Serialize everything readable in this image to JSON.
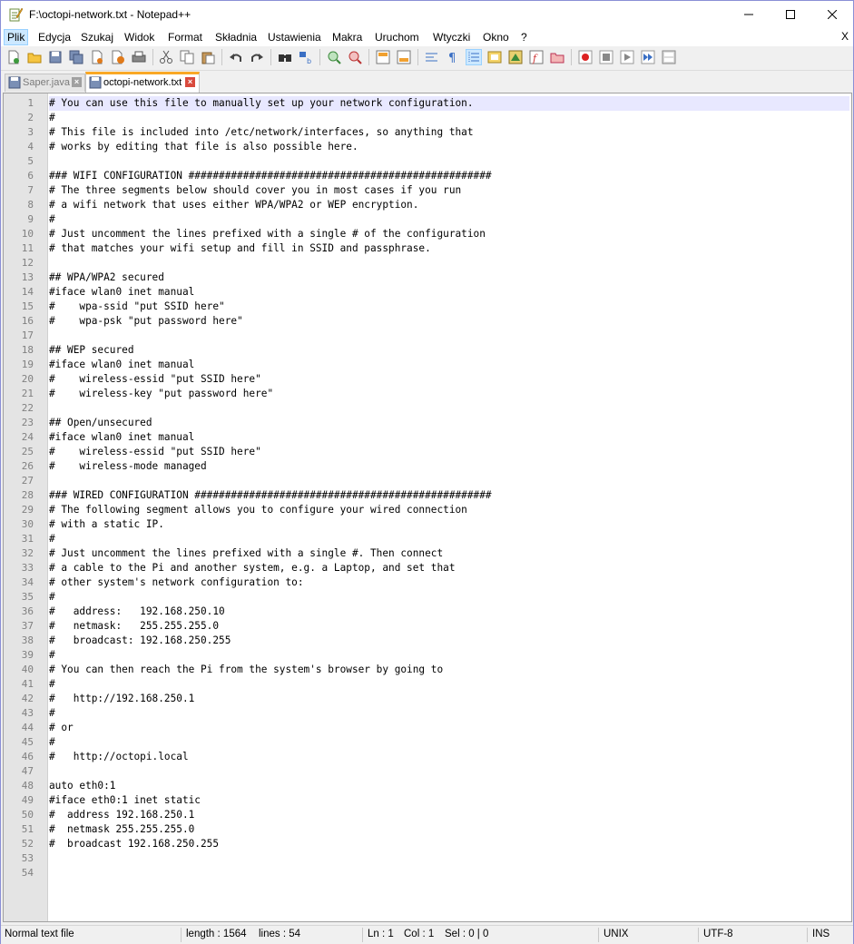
{
  "window": {
    "title": "F:\\octopi-network.txt - Notepad++"
  },
  "menu": [
    "Plik",
    "Edycja",
    "Szukaj",
    "Widok",
    "Format",
    "Składnia",
    "Ustawienia",
    "Makra",
    "Uruchom",
    "Wtyczki",
    "Okno",
    "?"
  ],
  "menu_close": "X",
  "tabs": [
    {
      "label": "Saper.java"
    },
    {
      "label": "octopi-network.txt"
    }
  ],
  "editor": {
    "lines": [
      "# You can use this file to manually set up your network configuration.",
      "#",
      "# This file is included into /etc/network/interfaces, so anything that",
      "# works by editing that file is also possible here.",
      "",
      "### WIFI CONFIGURATION ##################################################",
      "# The three segments below should cover you in most cases if you run",
      "# a wifi network that uses either WPA/WPA2 or WEP encryption.",
      "#",
      "# Just uncomment the lines prefixed with a single # of the configuration",
      "# that matches your wifi setup and fill in SSID and passphrase.",
      "",
      "## WPA/WPA2 secured",
      "#iface wlan0 inet manual",
      "#    wpa-ssid \"put SSID here\"",
      "#    wpa-psk \"put password here\"",
      "",
      "## WEP secured",
      "#iface wlan0 inet manual",
      "#    wireless-essid \"put SSID here\"",
      "#    wireless-key \"put password here\"",
      "",
      "## Open/unsecured",
      "#iface wlan0 inet manual",
      "#    wireless-essid \"put SSID here\"",
      "#    wireless-mode managed",
      "",
      "### WIRED CONFIGURATION #################################################",
      "# The following segment allows you to configure your wired connection",
      "# with a static IP.",
      "#",
      "# Just uncomment the lines prefixed with a single #. Then connect",
      "# a cable to the Pi and another system, e.g. a Laptop, and set that",
      "# other system's network configuration to:",
      "#",
      "#   address:   192.168.250.10",
      "#   netmask:   255.255.255.0",
      "#   broadcast: 192.168.250.255",
      "#",
      "# You can then reach the Pi from the system's browser by going to",
      "#",
      "#   http://192.168.250.1",
      "#",
      "# or",
      "#",
      "#   http://octopi.local",
      "",
      "auto eth0:1",
      "#iface eth0:1 inet static",
      "#  address 192.168.250.1",
      "#  netmask 255.255.255.0",
      "#  broadcast 192.168.250.255",
      "",
      ""
    ]
  },
  "status": {
    "filetype": "Normal text file",
    "length": "length : 1564",
    "lines": "lines : 54",
    "ln": "Ln : 1",
    "col": "Col : 1",
    "sel": "Sel : 0 | 0",
    "eol": "UNIX",
    "encoding": "UTF-8",
    "mode": "INS"
  },
  "colors": {
    "accent_tab": "#f9a825",
    "current_line": "#e8e8ff",
    "gutter": "#e4e4e4",
    "title_border": "#8a8fd6"
  }
}
